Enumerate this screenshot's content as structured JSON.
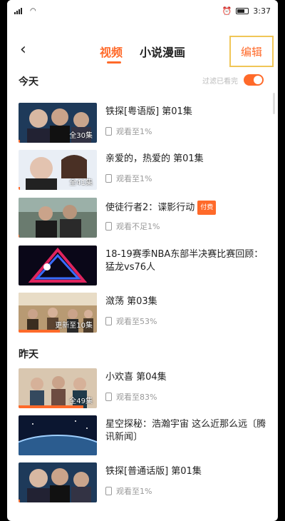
{
  "status": {
    "time": "3:37"
  },
  "header": {
    "back_icon": "back-chevron-icon",
    "tabs": [
      {
        "label": "视频",
        "active": true
      },
      {
        "label": "小说漫画",
        "active": false
      }
    ],
    "edit_label": "编辑"
  },
  "sections": [
    {
      "title": "今天",
      "filter_label": "过滤已看完",
      "items": [
        {
          "title": "铁探[粤语版] 第01集",
          "progress": "观看至1%",
          "caption": "全30集",
          "paid": false
        },
        {
          "title": "亲爱的，热爱的 第01集",
          "progress": "观看至1%",
          "caption": "全41集",
          "paid": false
        },
        {
          "title": "使徒行者2：谍影行动",
          "paid_label": "付费",
          "progress": "观看不足1%",
          "caption": "",
          "paid": true
        },
        {
          "title": "18-19赛季NBA东部半决赛比赛回顾：猛龙vs76人",
          "progress": "",
          "caption": "",
          "paid": false
        },
        {
          "title": "潋荡 第03集",
          "progress": "观看至53%",
          "caption": "更新至10集",
          "paid": false
        }
      ]
    },
    {
      "title": "昨天",
      "items": [
        {
          "title": "小欢喜 第04集",
          "progress": "观看至83%",
          "caption": "全49集",
          "paid": false
        },
        {
          "title": "星空探秘：浩瀚宇宙 这么近那么远〔腾讯新闻〕",
          "progress": "",
          "caption": "",
          "paid": false
        },
        {
          "title": "铁探[普通话版] 第01集",
          "progress": "观看至1%",
          "caption": "",
          "paid": false
        }
      ]
    }
  ],
  "colors": {
    "accent": "#ff6a2a",
    "edit_highlight": "#f0c657"
  }
}
